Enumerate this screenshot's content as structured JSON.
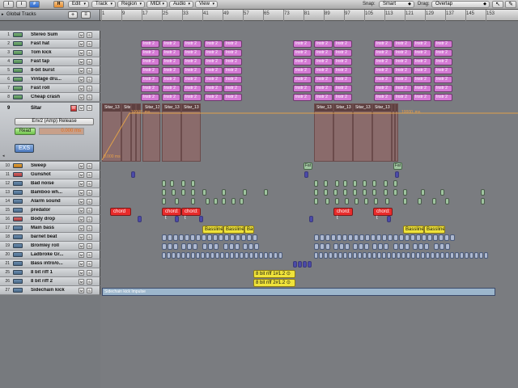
{
  "toolbar": {
    "btn_i": "i",
    "btn_hash": "#",
    "btn_h": "H",
    "menus": {
      "edit": "Edit",
      "track": "Track",
      "region": "Region",
      "midi": "MIDI",
      "audio": "Audio",
      "view": "View"
    },
    "snap_label": "Snap:",
    "snap_value": "Smart",
    "drag_label": "Drag:",
    "drag_value": "Overlap",
    "pointer_tool": "↖",
    "pencil_tool": "✎"
  },
  "header": {
    "title": "Global Tracks",
    "plus": "+",
    "sq": "≡"
  },
  "ruler": {
    "ticks": [
      "1",
      "9",
      "17",
      "25",
      "33",
      "41",
      "49",
      "57",
      "65",
      "73",
      "81",
      "89",
      "97",
      "105",
      "113",
      "121",
      "129",
      "137",
      "145",
      "153"
    ]
  },
  "tracks": [
    {
      "num": "1",
      "name": "Stereo Sum",
      "icon": "green"
    },
    {
      "num": "2",
      "name": "Fast hat",
      "icon": "green"
    },
    {
      "num": "3",
      "name": "Tom kick",
      "icon": "green"
    },
    {
      "num": "4",
      "name": "Fast tap",
      "icon": "green"
    },
    {
      "num": "5",
      "name": "8-bit burst",
      "icon": "green"
    },
    {
      "num": "6",
      "name": "Vintage dru...",
      "icon": "green"
    },
    {
      "num": "7",
      "name": "Fast roll",
      "icon": "green"
    },
    {
      "num": "8",
      "name": "Cheap crash",
      "icon": "green"
    },
    {
      "num": "10",
      "name": "Sweep",
      "icon": "orange"
    },
    {
      "num": "11",
      "name": "Gunshot",
      "icon": "red"
    },
    {
      "num": "12",
      "name": "Bad noise",
      "icon": "blue"
    },
    {
      "num": "13",
      "name": "Bamboo wh...",
      "icon": "blue"
    },
    {
      "num": "14",
      "name": "Alarm sound",
      "icon": "blue"
    },
    {
      "num": "15",
      "name": "predator",
      "icon": "blue"
    },
    {
      "num": "16",
      "name": "Body drop",
      "icon": "red"
    },
    {
      "num": "17",
      "name": "Main bass",
      "icon": "blue"
    },
    {
      "num": "18",
      "name": "barnet beat",
      "icon": "blue"
    },
    {
      "num": "19",
      "name": "Bromley roll",
      "icon": "blue"
    },
    {
      "num": "20",
      "name": "Ladbroke Gr...",
      "icon": "blue"
    },
    {
      "num": "21",
      "name": "Bass intro/o...",
      "icon": "blue"
    },
    {
      "num": "25",
      "name": "8 bit riff 1",
      "icon": "blue"
    },
    {
      "num": "26",
      "name": "8 bit riff 2",
      "icon": "blue"
    },
    {
      "num": "27",
      "name": "Sidechain kick",
      "icon": "blue"
    }
  ],
  "sitar": {
    "num": "9",
    "name": "Sitar",
    "rec": "R",
    "mute": "M",
    "solo": "S",
    "env": "Env2 (Amp) Release",
    "read": "Read",
    "value": "0.000 ms",
    "exs": "EXS"
  },
  "arrange": {
    "instr_label": "Instr 2",
    "sitar_label": "Sitar_13",
    "sitar_label_short": "Sita",
    "auto_top": "10000. ms",
    "auto_bottom": "0.000 ms",
    "fat_label": "Fat",
    "chord_label": "chord: t",
    "chord_label2": "chord",
    "bassline_label": "Bassline",
    "bass_short": "Bas",
    "riff1": "8 bit riff 1#1.2 ⊙",
    "riff2": "8 bit riff 2#1.2 ⊙",
    "sidechain": "Sidechain kick Impulse"
  }
}
